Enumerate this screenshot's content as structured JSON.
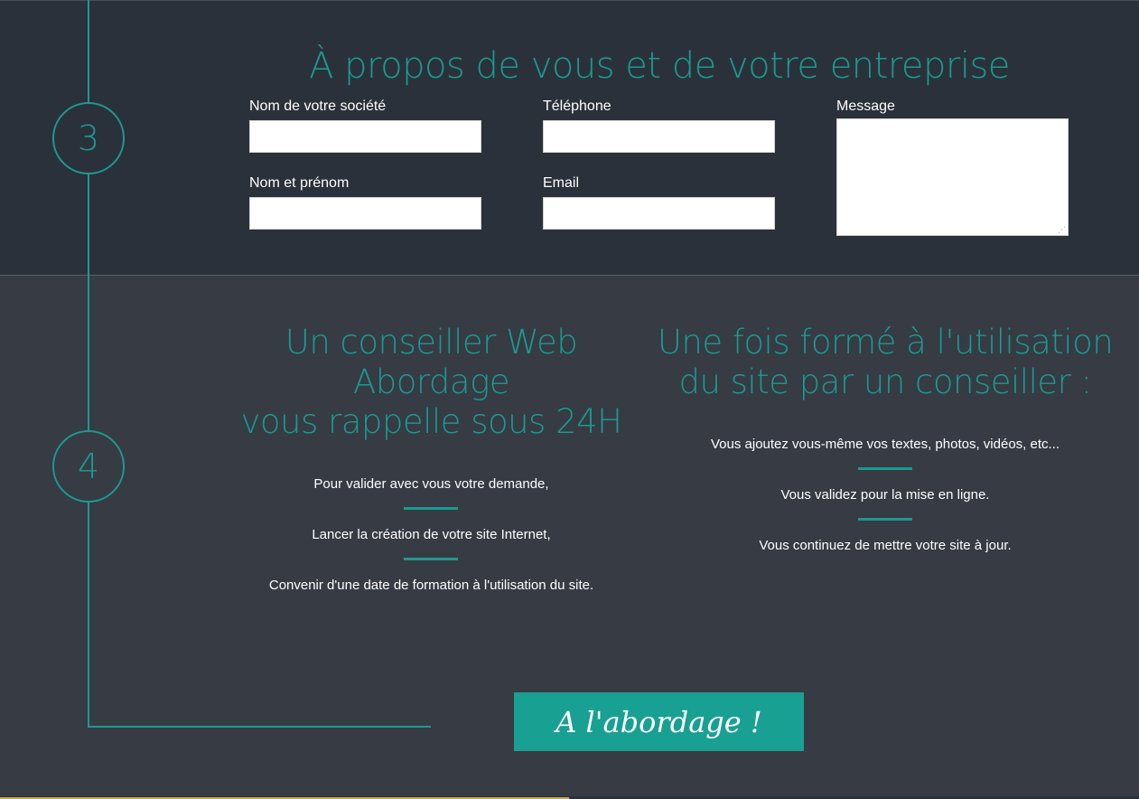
{
  "section3": {
    "step_number": "3",
    "title": "À propos de vous et de votre entreprise",
    "fields": {
      "company_label": "Nom de votre société",
      "phone_label": "Téléphone",
      "message_label": "Message",
      "name_label": "Nom et prénom",
      "email_label": "Email"
    }
  },
  "section4": {
    "step_number": "4",
    "left": {
      "title_line1": "Un conseiller Web",
      "title_line2": "Abordage",
      "title_line3": "vous rappelle sous 24H",
      "items": [
        "Pour valider avec vous votre demande,",
        "Lancer la création de votre site Internet,",
        "Convenir d'une date de formation à l'utilisation du site."
      ]
    },
    "right": {
      "title_line1": "Une fois formé à l'utilisation",
      "title_line2": "du site par un conseiller :",
      "items": [
        "Vous ajoutez vous-même vos textes, photos, vidéos, etc...",
        "Vous validez pour la mise en ligne.",
        "Vous continuez de mettre votre site à jour."
      ]
    }
  },
  "cta": {
    "label": "A l'abordage !"
  },
  "colors": {
    "accent": "#1a9b90",
    "section3_bg": "#2b313a",
    "section4_bg": "#363b44"
  }
}
